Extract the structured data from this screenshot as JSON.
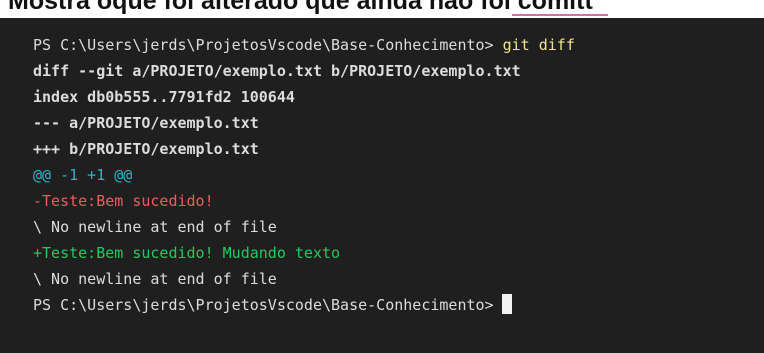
{
  "caption": {
    "text": "Mostra oque foi alterado que ainda não foi comitt"
  },
  "terminal": {
    "prompt": "PS C:\\Users\\jerds\\ProjetosVscode\\Base-Conhecimento>",
    "command": "git diff",
    "diff_header": "diff --git a/PROJETO/exemplo.txt b/PROJETO/exemplo.txt",
    "index_line": "index db0b555..7791fd2 100644",
    "old_file": "--- a/PROJETO/exemplo.txt",
    "new_file": "+++ b/PROJETO/exemplo.txt",
    "hunk_header": "@@ -1 +1 @@",
    "removed_line": "-Teste:Bem sucedido!",
    "no_newline_1": "\\ No newline at end of file",
    "added_line": "+Teste:Bem sucedido! Mudando texto",
    "no_newline_2": "\\ No newline at end of file",
    "final_prompt": "PS C:\\Users\\jerds\\ProjetosVscode\\Base-Conhecimento>"
  },
  "colors": {
    "background": "#1f1f1f",
    "text": "#dcdcdc",
    "command": "#f0e68c",
    "hunk": "#2ab6c7",
    "removed": "#f25b5b",
    "added": "#23c95f"
  }
}
